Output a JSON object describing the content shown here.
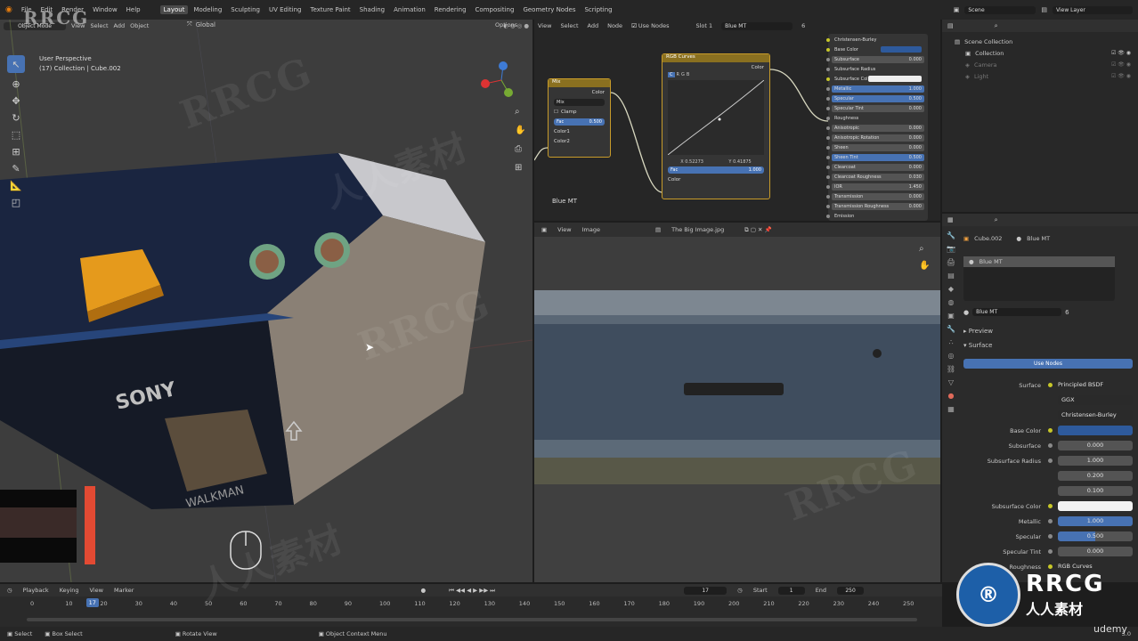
{
  "menu": {
    "items": [
      "File",
      "Edit",
      "Render",
      "Window",
      "Help"
    ],
    "workspaces": [
      "Layout",
      "Modeling",
      "Sculpting",
      "UV Editing",
      "Texture Paint",
      "Shading",
      "Animation",
      "Rendering",
      "Compositing",
      "Geometry Nodes",
      "Scripting"
    ],
    "scene": "Scene",
    "view_layer": "View Layer"
  },
  "viewport": {
    "mode": "Object Mode",
    "menus": [
      "View",
      "Select",
      "Add",
      "Object"
    ],
    "orientation": "Global",
    "options": "Options",
    "perspective": "User Perspective",
    "collection_info": "(17) Collection | Cube.002",
    "logo": "SONY",
    "brand": "WALKMAN"
  },
  "node_editor": {
    "menus": [
      "View",
      "Select",
      "Add",
      "Node"
    ],
    "use_nodes": "Use Nodes",
    "slot": "Slot 1",
    "material": "Blue MT",
    "users": "6",
    "label": "Blue MT",
    "mix_node": {
      "title": "Mix",
      "out": "Color",
      "blend": "Mix",
      "clamp": "Clamp",
      "fac_label": "Fac",
      "fac": "0.500",
      "in1": "Color1",
      "in2": "Color2"
    },
    "curves_node": {
      "title": "RGB Curves",
      "out": "Color",
      "channels": [
        "C",
        "R",
        "G",
        "B"
      ],
      "x": "X 0.52273",
      "y": "Y 0.41875",
      "fac_label": "Fac",
      "fac": "1.000",
      "in": "Color"
    },
    "bsdf": {
      "rows": [
        {
          "label": "Christensen-Burley",
          "val": ""
        },
        {
          "label": "Base Color",
          "val": ""
        },
        {
          "label": "Subsurface",
          "val": "0.000"
        },
        {
          "label": "Subsurface Radius",
          "val": ""
        },
        {
          "label": "Subsurface Col",
          "val": ""
        },
        {
          "label": "Metallic",
          "val": "1.000"
        },
        {
          "label": "Specular",
          "val": "0.500"
        },
        {
          "label": "Specular Tint",
          "val": "0.000"
        },
        {
          "label": "Roughness",
          "val": ""
        },
        {
          "label": "Anisotropic",
          "val": "0.000"
        },
        {
          "label": "Anisotropic Rotation",
          "val": "0.000"
        },
        {
          "label": "Sheen",
          "val": "0.000"
        },
        {
          "label": "Sheen Tint",
          "val": "0.500"
        },
        {
          "label": "Clearcoat",
          "val": "0.000"
        },
        {
          "label": "Clearcoat Roughness",
          "val": "0.030"
        },
        {
          "label": "IOR",
          "val": "1.450"
        },
        {
          "label": "Transmission",
          "val": "0.000"
        },
        {
          "label": "Transmission Roughness",
          "val": "0.000"
        },
        {
          "label": "Emission",
          "val": ""
        }
      ]
    }
  },
  "outliner": {
    "items": [
      {
        "label": "Scene Collection"
      },
      {
        "label": "Collection"
      },
      {
        "label": "Camera"
      },
      {
        "label": "Light"
      }
    ]
  },
  "image_editor": {
    "menus": [
      "View",
      "Image"
    ],
    "image_name": "The Big Image.jpg"
  },
  "properties": {
    "object": "Cube.002",
    "material": "Blue MT",
    "slot_item": "Blue MT",
    "mat_field": "Blue MT",
    "users": "6",
    "preview": "Preview",
    "surface": "Surface",
    "use_nodes": "Use Nodes",
    "rows": [
      {
        "label": "Surface",
        "val": "Principled BSDF",
        "type": "link"
      },
      {
        "label": "",
        "val": "GGX",
        "type": "drop"
      },
      {
        "label": "",
        "val": "Christensen-Burley",
        "type": "drop"
      },
      {
        "label": "Base Color",
        "val": "",
        "type": "color"
      },
      {
        "label": "Subsurface",
        "val": "0.000",
        "type": "num"
      },
      {
        "label": "Subsurface Radius",
        "val": "1.000",
        "type": "num"
      },
      {
        "label": "",
        "val": "0.200",
        "type": "num"
      },
      {
        "label": "",
        "val": "0.100",
        "type": "num"
      },
      {
        "label": "Subsurface Color",
        "val": "",
        "type": "white"
      },
      {
        "label": "Metallic",
        "val": "1.000",
        "type": "bar"
      },
      {
        "label": "Specular",
        "val": "0.500",
        "type": "half"
      },
      {
        "label": "Specular Tint",
        "val": "0.000",
        "type": "num"
      },
      {
        "label": "Roughness",
        "val": "RGB Curves",
        "type": "link"
      }
    ]
  },
  "timeline": {
    "menus": [
      "Playback",
      "Keying",
      "View",
      "Marker"
    ],
    "frame": "17",
    "start_label": "Start",
    "start": "1",
    "end_label": "End",
    "end": "250",
    "ticks": [
      "0",
      "10",
      "20",
      "30",
      "40",
      "50",
      "60",
      "70",
      "80",
      "90",
      "100",
      "110",
      "120",
      "130",
      "140",
      "150",
      "160",
      "170",
      "180",
      "190",
      "200",
      "210",
      "220",
      "230",
      "240",
      "250"
    ]
  },
  "statusbar": {
    "select": "Select",
    "box": "Box Select",
    "rotate": "Rotate View",
    "context": "Object Context Menu",
    "version": "3.0"
  },
  "watermarks": [
    "RRCG",
    "人人素材",
    "udemy"
  ],
  "colors": {
    "accent": "#4772b3",
    "node_header": "#c79b2a",
    "orange": "#e59a1c"
  }
}
